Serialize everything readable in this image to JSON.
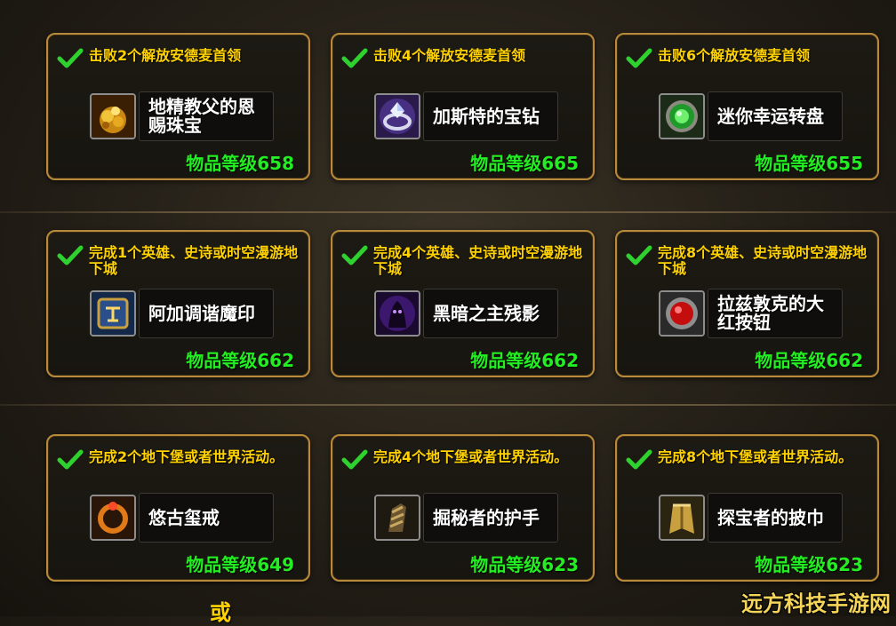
{
  "rewards": [
    {
      "requirement": "击败2个解放安德麦首领",
      "item": "地精教父的恩赐珠宝",
      "item_level": "物品等级658",
      "icon": "gold-treasure-icon"
    },
    {
      "requirement": "击败4个解放安德麦首领",
      "item": "加斯特的宝钻",
      "item_level": "物品等级665",
      "icon": "diamond-ring-icon"
    },
    {
      "requirement": "击败6个解放安德麦首领",
      "item": "迷你幸运转盘",
      "item_level": "物品等级655",
      "icon": "lucky-wheel-icon"
    },
    {
      "requirement": "完成1个英雄、史诗或时空漫游地下城",
      "item": "阿加调谐魔印",
      "item_level": "物品等级662",
      "icon": "rune-sigil-icon"
    },
    {
      "requirement": "完成4个英雄、史诗或时空漫游地下城",
      "item": "黑暗之主残影",
      "item_level": "物品等级662",
      "icon": "shadow-lord-icon"
    },
    {
      "requirement": "完成8个英雄、史诗或时空漫游地下城",
      "item": "拉兹敦克的大红按钮",
      "item_level": "物品等级662",
      "icon": "red-button-icon"
    },
    {
      "requirement": "完成2个地下堡或者世界活动。",
      "item": "悠古玺戒",
      "item_level": "物品等级649",
      "icon": "ring-icon"
    },
    {
      "requirement": "完成4个地下堡或者世界活动。",
      "item": "掘秘者的护手",
      "item_level": "物品等级623",
      "icon": "gauntlet-icon"
    },
    {
      "requirement": "完成8个地下堡或者世界活动。",
      "item": "探宝者的披巾",
      "item_level": "物品等级623",
      "icon": "cloak-icon"
    }
  ],
  "footer": {
    "or_label": "或"
  },
  "watermark": "远方科技手游网",
  "colors": {
    "requirement": "#ffd200",
    "item_level": "#22ee22",
    "border": "#b98a3c",
    "check": "#2fd12f"
  }
}
